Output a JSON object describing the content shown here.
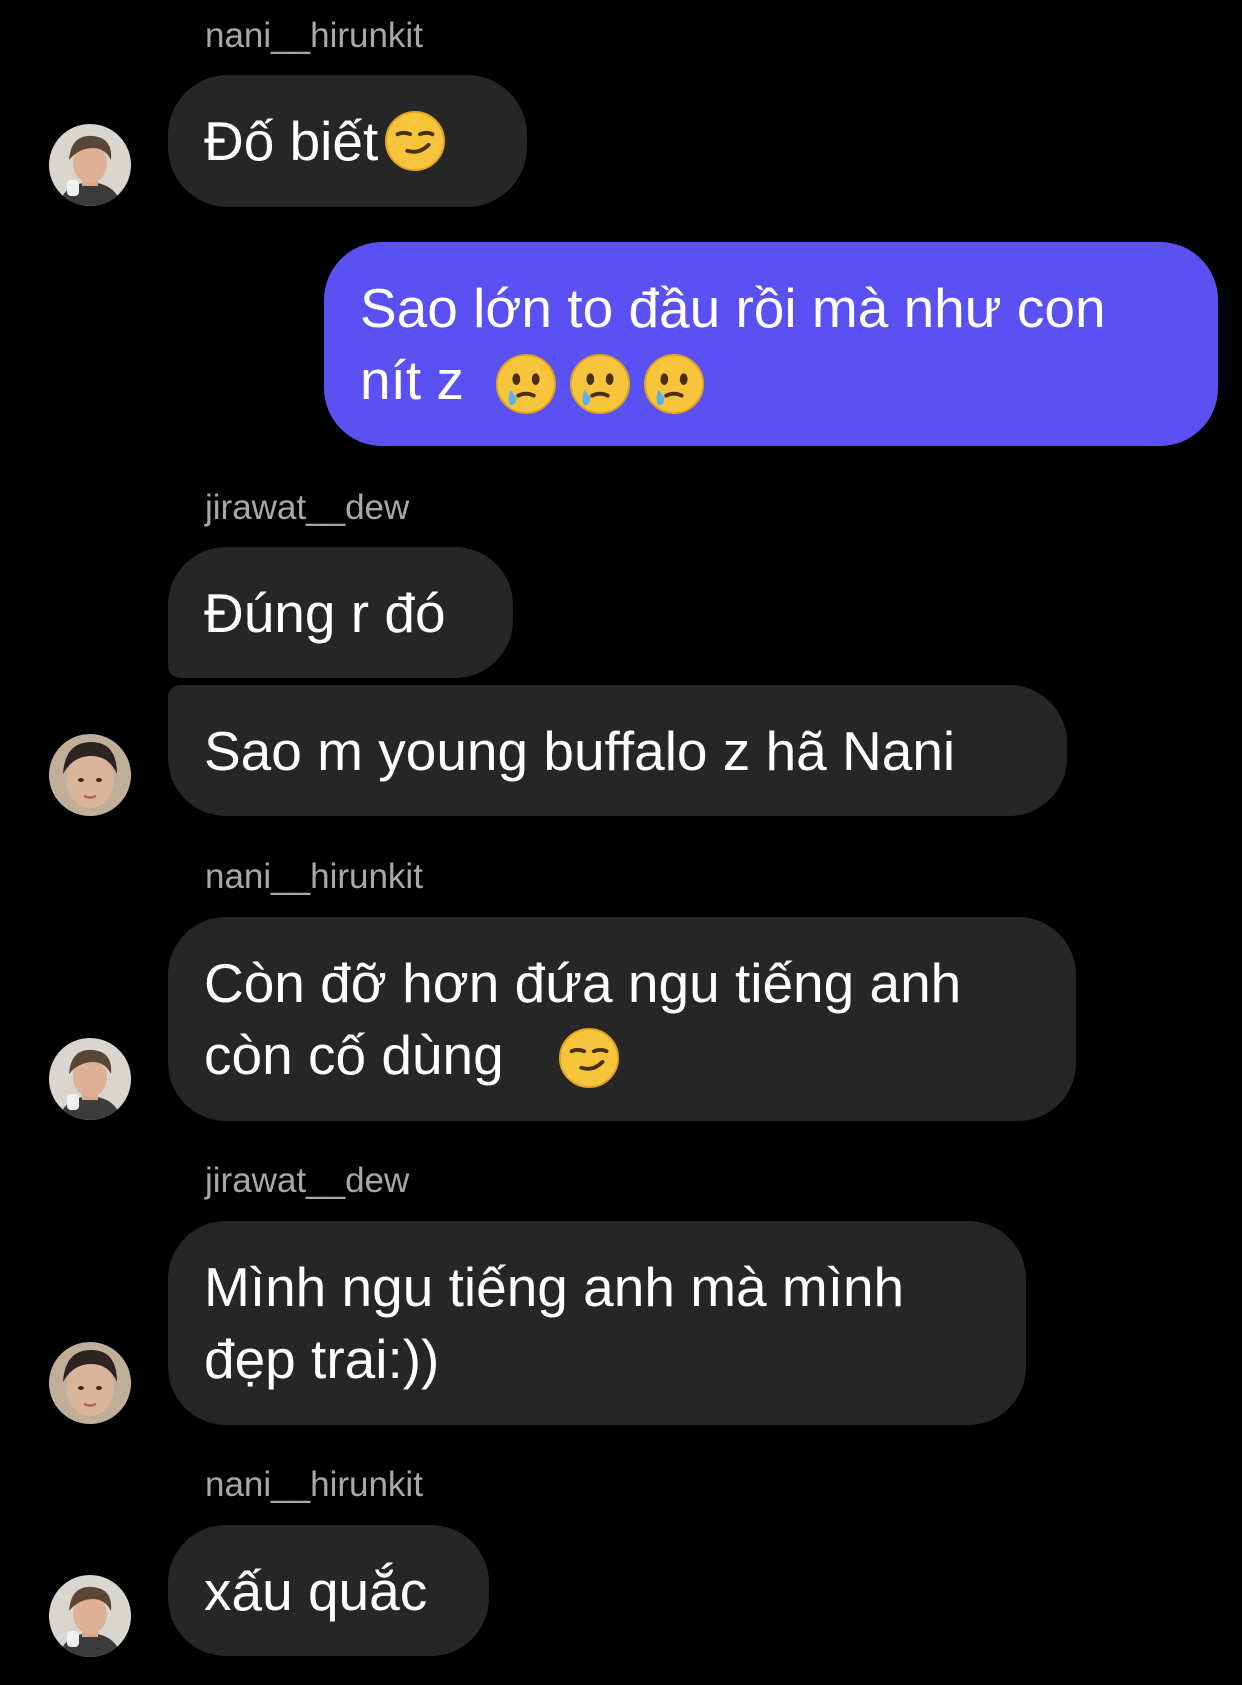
{
  "conversation": {
    "names": {
      "n1": "nani__hirunkit",
      "n2": "jirawat__dew",
      "n3": "nani__hirunkit",
      "n4": "jirawat__dew",
      "n5": "nani__hirunkit"
    },
    "messages": {
      "m1": "Đố biết",
      "m2": "Sao lớn to đầu rồi mà như con\nnít z",
      "m3": "Đúng r đó",
      "m4": "Sao m young buffalo z hã Nani",
      "m5": "Còn đỡ hơn đứa ngu tiếng anh\ncòn cố dùng",
      "m6": "Mình ngu tiếng anh mà mình\nđẹp trai:))",
      "m7": "xấu quắc"
    },
    "emojis": {
      "m1": "smirking-face",
      "m2": "face-holding-back-tears",
      "m5": "smirking-face"
    }
  },
  "colors": {
    "background": "#000000",
    "incoming_bubble": "#262626",
    "outgoing_bubble": "#5b51f2",
    "sender_name": "#a8a8a8",
    "text": "#ffffff"
  }
}
